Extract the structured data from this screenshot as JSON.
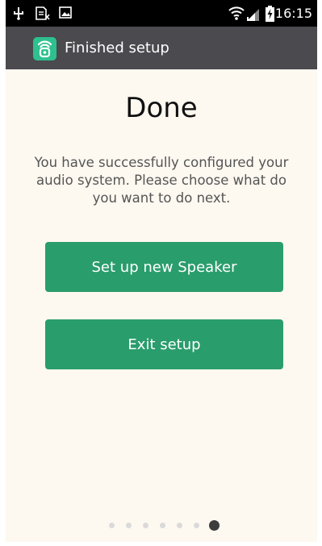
{
  "status_bar": {
    "time": "16:15",
    "icons": [
      "usb-icon",
      "sim-icon",
      "image-icon",
      "wifi-icon",
      "signal-icon",
      "battery-charging-icon"
    ]
  },
  "action_bar": {
    "title": "Finished setup",
    "app_icon": "speaker-app-icon"
  },
  "main": {
    "heading": "Done",
    "message": "You have successfully configured your audio system. Please choose what do you want to do next.",
    "buttons": {
      "setup_label": "Set up new Speaker",
      "exit_label": "Exit setup"
    }
  },
  "pager": {
    "total": 7,
    "current": 7
  },
  "colors": {
    "accent": "#2a9d6c",
    "action_bar": "#4a4a4f",
    "background": "#fdf8f0",
    "app_icon": "#2ec08e"
  }
}
